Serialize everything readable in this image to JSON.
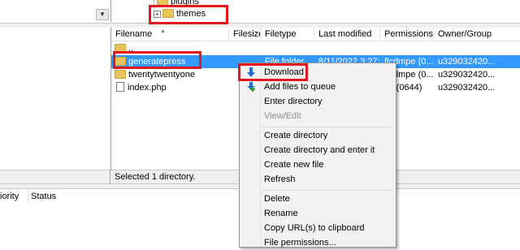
{
  "tree": {
    "items": [
      {
        "label": "plugins"
      },
      {
        "label": "themes"
      }
    ]
  },
  "file_list": {
    "columns": [
      "Filename",
      "Filesize",
      "Filetype",
      "Last modified",
      "Permissions",
      "Owner/Group"
    ],
    "rows": [
      {
        "name": "..",
        "size": "",
        "type": "",
        "modified": "",
        "perms": "",
        "owner": ""
      },
      {
        "name": "generatepress",
        "size": "",
        "type": "File folder",
        "modified": "8/11/2022 3:27:...",
        "perms": "flcdmpe (0...",
        "owner": "u329032420..."
      },
      {
        "name": "twentytwentyone",
        "size": "",
        "type": "",
        "modified": "",
        "perms": "flcdmpe (0...",
        "owner": "u329032420..."
      },
      {
        "name": "index.php",
        "size": "",
        "type": "",
        "modified": "",
        "perms": "rw (0644)",
        "owner": "u329032420..."
      }
    ],
    "status": "Selected 1 directory."
  },
  "queue": {
    "columns": [
      "iority",
      "Status"
    ]
  },
  "context_menu": {
    "items": [
      {
        "label": "Download",
        "icon": "download-arrow-icon"
      },
      {
        "label": "Add files to queue",
        "icon": "add-to-queue-icon"
      },
      {
        "label": "Enter directory"
      },
      {
        "label": "View/Edit"
      },
      {
        "label": "Create directory"
      },
      {
        "label": "Create directory and enter it"
      },
      {
        "label": "Create new file"
      },
      {
        "label": "Refresh"
      },
      {
        "label": "Delete"
      },
      {
        "label": "Rename"
      },
      {
        "label": "Copy URL(s) to clipboard"
      },
      {
        "label": "File permissions..."
      }
    ]
  },
  "colors": {
    "selection": "#3399ff",
    "highlight_box": "#e1161e",
    "download_icon": "#1f6fd1"
  }
}
